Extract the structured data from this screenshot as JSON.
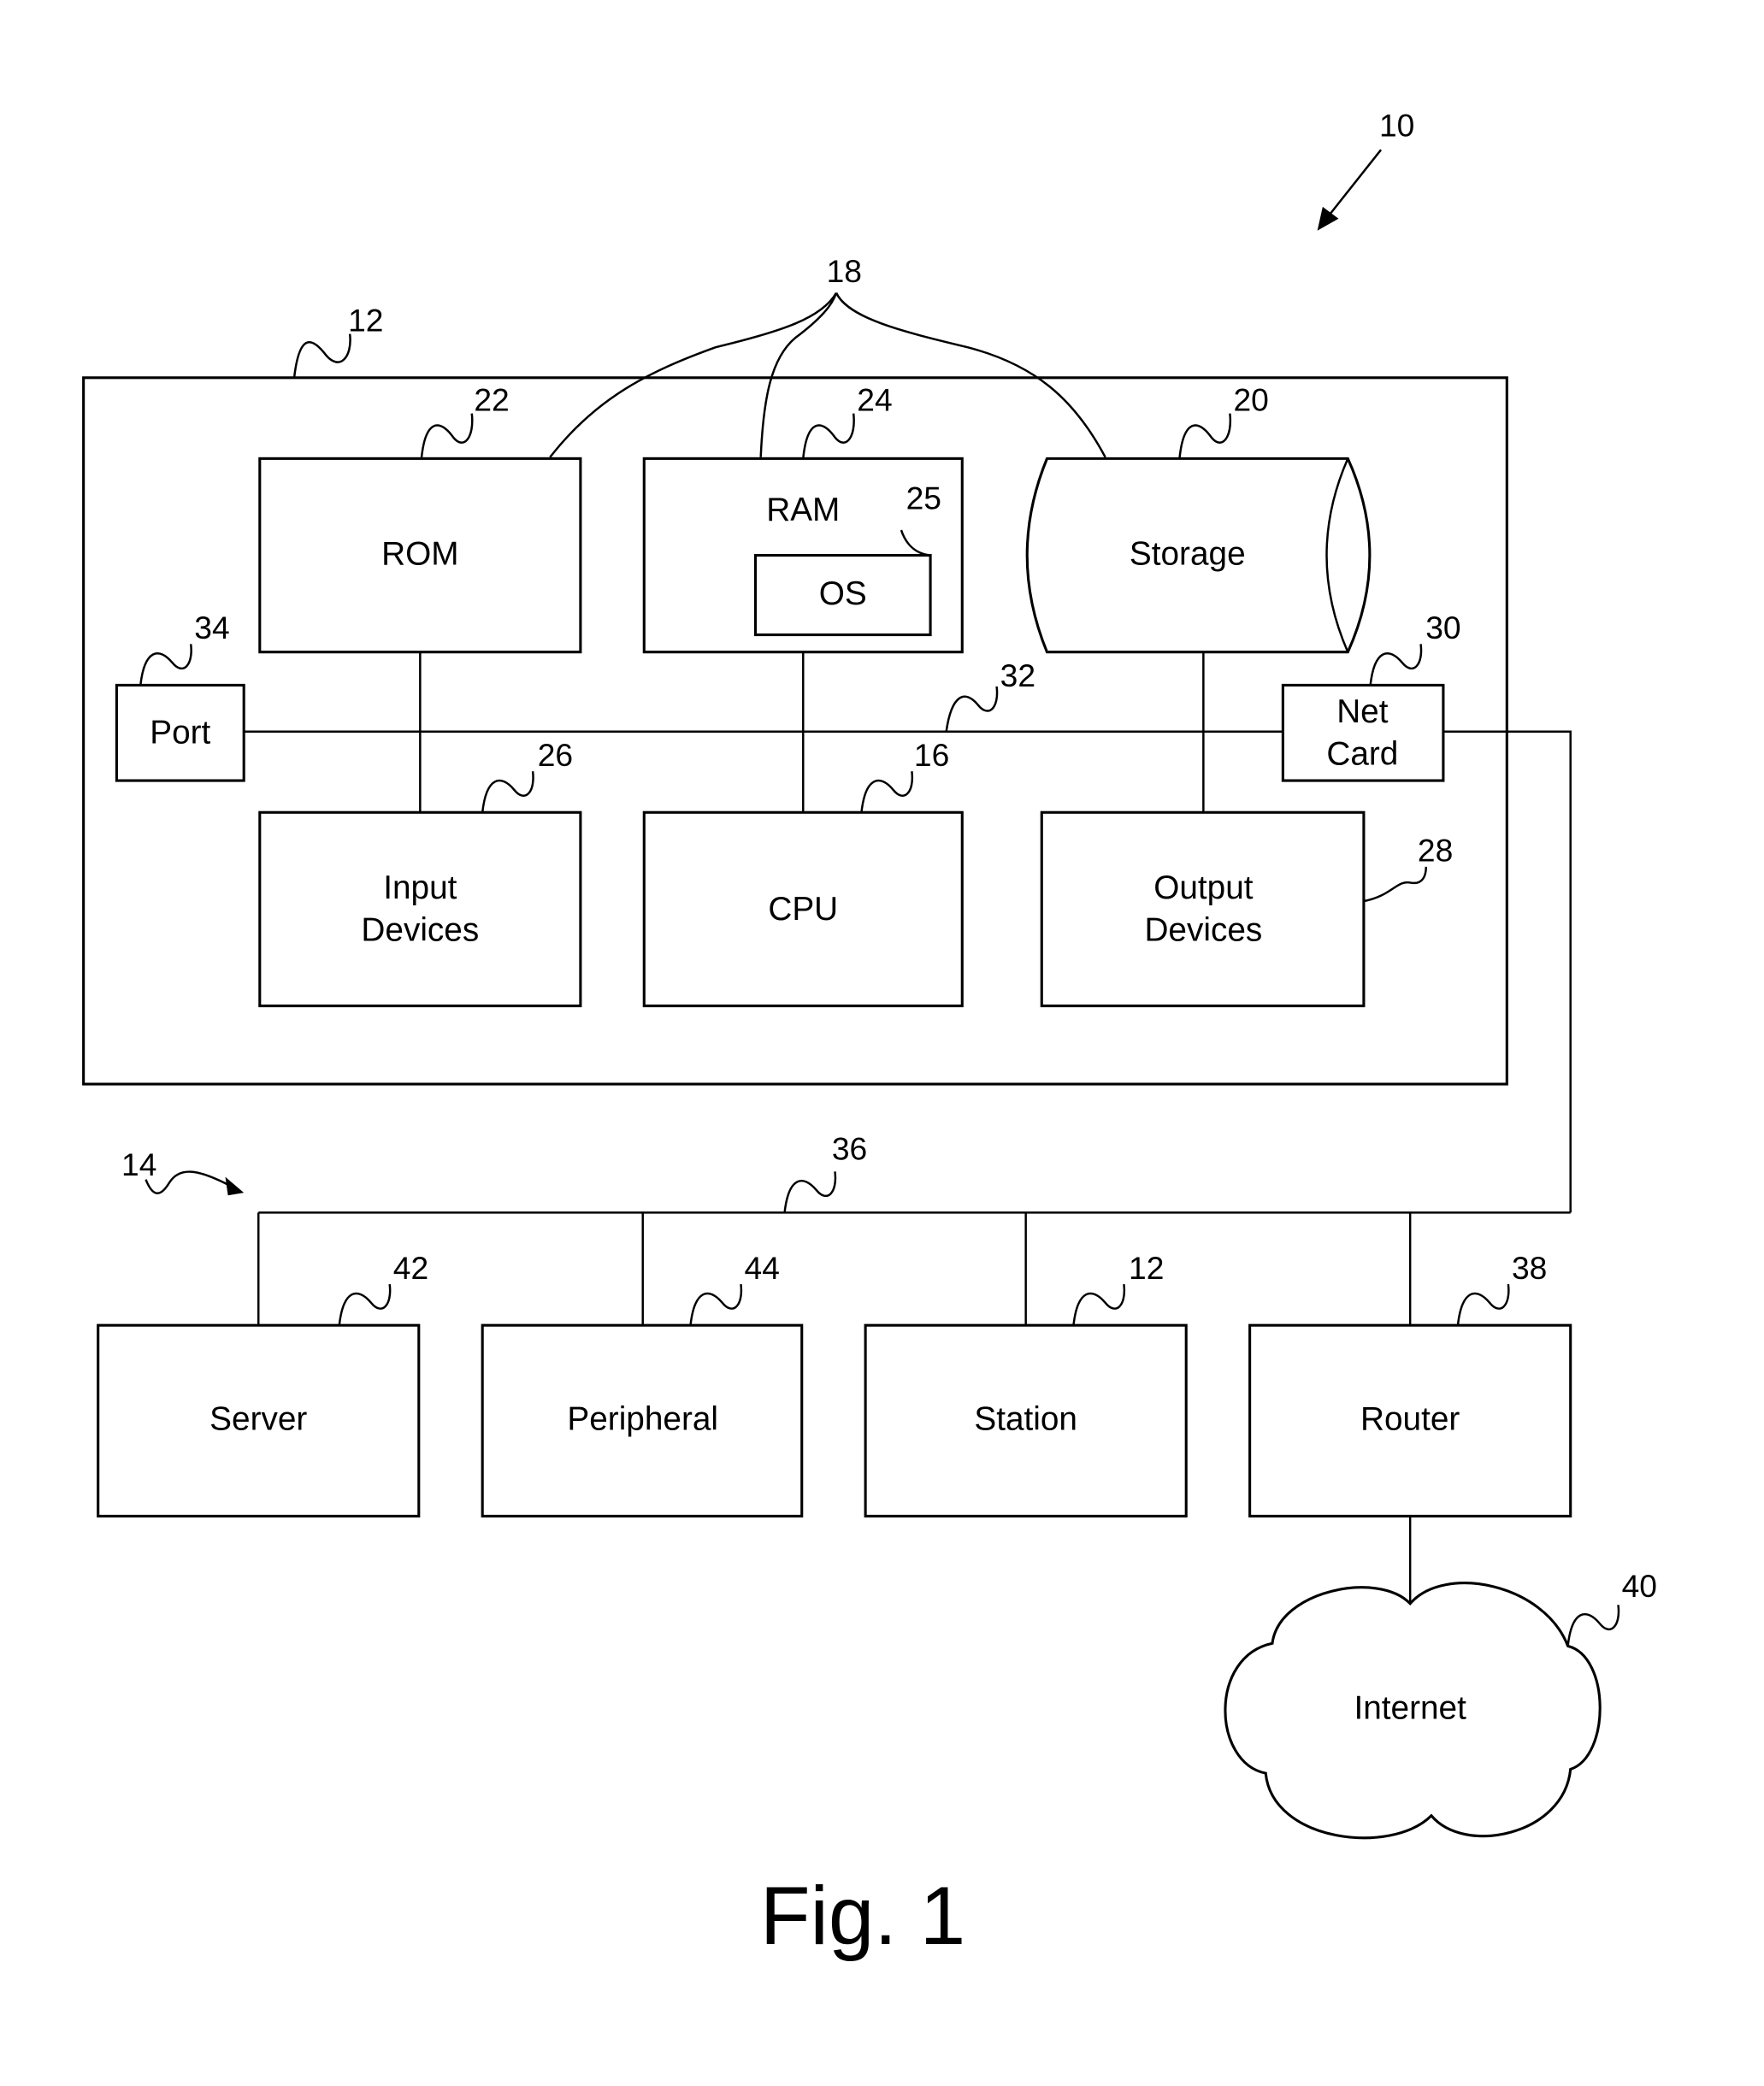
{
  "figure": {
    "caption": "Fig. 1",
    "system_ref": "10"
  },
  "computer": {
    "ref": "12",
    "bus_ref": "18",
    "internal_bus_ref": "32",
    "components": {
      "rom": {
        "label": "ROM",
        "ref": "22"
      },
      "ram": {
        "label": "RAM",
        "ref": "24"
      },
      "os": {
        "label": "OS",
        "ref": "25"
      },
      "storage": {
        "label": "Storage",
        "ref": "20"
      },
      "port": {
        "label": "Port",
        "ref": "34"
      },
      "net_card": {
        "label_line1": "Net",
        "label_line2": "Card",
        "ref": "30"
      },
      "input_devices": {
        "label_line1": "Input",
        "label_line2": "Devices",
        "ref": "26"
      },
      "cpu": {
        "label": "CPU",
        "ref": "16"
      },
      "output_devices": {
        "label_line1": "Output",
        "label_line2": "Devices",
        "ref": "28"
      }
    }
  },
  "network": {
    "ref": "14",
    "bus_ref": "36",
    "nodes": {
      "server": {
        "label": "Server",
        "ref": "42"
      },
      "peripheral": {
        "label": "Peripheral",
        "ref": "44"
      },
      "station": {
        "label": "Station",
        "ref": "12"
      },
      "router": {
        "label": "Router",
        "ref": "38"
      }
    },
    "internet": {
      "label": "Internet",
      "ref": "40"
    }
  }
}
